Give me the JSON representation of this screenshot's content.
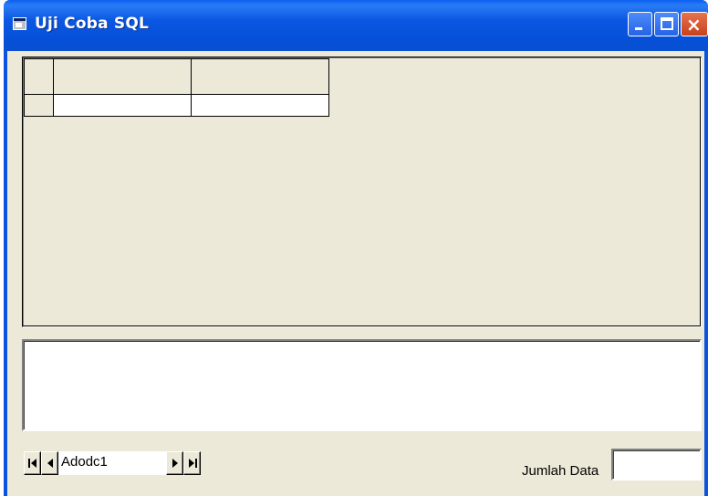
{
  "window": {
    "title": "Uji Coba SQL",
    "title_color": "#ffffff",
    "titlebar_color": "#0a55e0",
    "client_bg": "#ece9d8"
  },
  "title_buttons": {
    "minimize": "minimize-icon",
    "maximize": "maximize-icon",
    "close": "close-icon"
  },
  "grid": {
    "columns": [
      "",
      ""
    ],
    "rows": [
      [
        "",
        ""
      ]
    ]
  },
  "text_area": {
    "value": ""
  },
  "adodc": {
    "caption": "Adodc1",
    "buttons": [
      "first-record-icon",
      "previous-record-icon",
      "next-record-icon",
      "last-record-icon"
    ]
  },
  "count": {
    "label": "Jumlah Data",
    "value": ""
  }
}
